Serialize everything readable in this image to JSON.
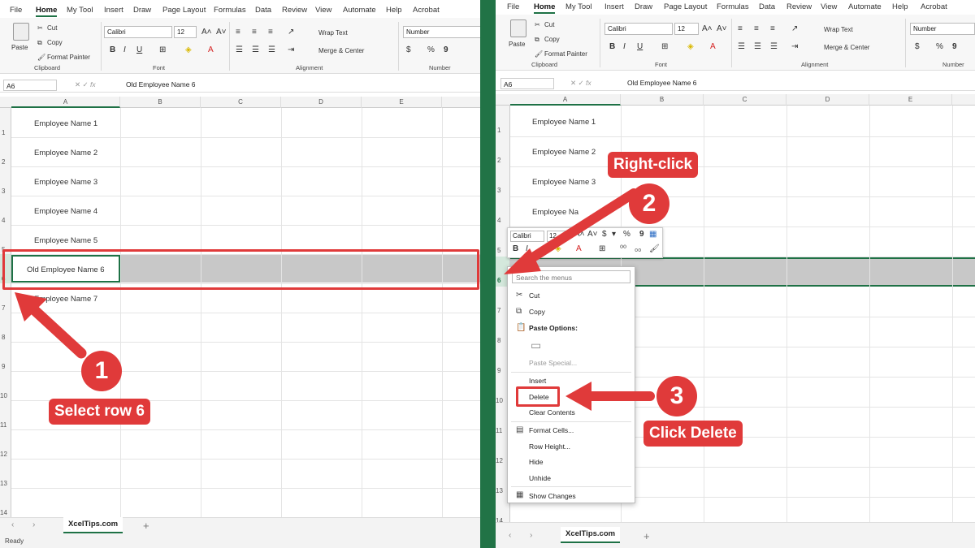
{
  "menu": [
    "File",
    "Home",
    "My Tool",
    "Insert",
    "Draw",
    "Page Layout",
    "Formulas",
    "Data",
    "Review",
    "View",
    "Automate",
    "Help",
    "Acrobat"
  ],
  "ribbon": {
    "paste": "Paste",
    "cut": "Cut",
    "copy": "Copy",
    "format_painter": "Format Painter",
    "clipboard": "Clipboard",
    "font_name": "Calibri",
    "font_size": "12",
    "font_group": "Font",
    "wrap_text": "Wrap Text",
    "merge_center": "Merge & Center",
    "alignment": "Alignment",
    "number_format": "Number",
    "number_group": "Number"
  },
  "formula_bar": {
    "name_box": "A6",
    "fx": "fx",
    "content": "Old Employee Name 6"
  },
  "columns": [
    "A",
    "B",
    "C",
    "D",
    "E"
  ],
  "rows": [
    "1",
    "2",
    "3",
    "4",
    "5",
    "6",
    "7",
    "8",
    "9",
    "10",
    "11",
    "12",
    "13",
    "14"
  ],
  "cells": {
    "a1": "Employee Name 1",
    "a2": "Employee Name 2",
    "a3": "Employee Name 3",
    "a4": "Employee Name 4",
    "a5": "Employee Name 5",
    "a6": "Old Employee Name 6",
    "a7": "Employee Name 7",
    "a4_partial": "Employee Na"
  },
  "sheet_tab": "XcelTips.com",
  "status": "Ready",
  "mini_toolbar": {
    "font": "Calibri",
    "size": "12"
  },
  "context_menu": {
    "search": "Search the menus",
    "items": [
      "Cut",
      "Copy",
      "Paste Options:",
      "Paste Special...",
      "Insert",
      "Delete",
      "Clear Contents",
      "Format Cells...",
      "Row Height...",
      "Hide",
      "Unhide",
      "Show Changes"
    ]
  },
  "annotations": {
    "step1": "1",
    "step1_label": "Select row 6",
    "step2": "2",
    "step2_label": "Right-click",
    "step3": "3",
    "step3_label": "Click Delete"
  },
  "colors": {
    "accent": "#e03a3a",
    "excel_green": "#217346",
    "selection_gray": "#c8c8c8"
  }
}
